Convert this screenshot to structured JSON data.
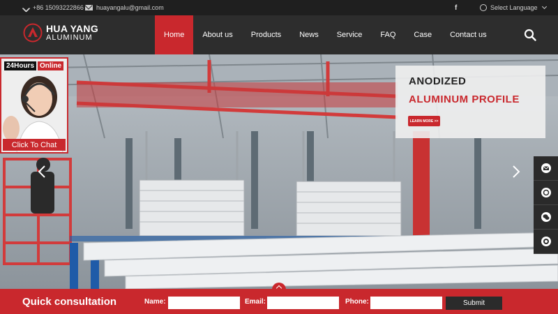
{
  "topbar": {
    "phone": "+86 15093222866",
    "email": "huayangalu@gmail.com",
    "facebook": "f",
    "language": "Select Language"
  },
  "logo": {
    "line1": "HUA YANG",
    "line2": "ALUMINUM"
  },
  "nav": {
    "items": [
      {
        "label": "Home",
        "active": true
      },
      {
        "label": "About us"
      },
      {
        "label": "Products"
      },
      {
        "label": "News"
      },
      {
        "label": "Service"
      },
      {
        "label": "FAQ"
      },
      {
        "label": "Case"
      },
      {
        "label": "Contact us"
      }
    ]
  },
  "hero": {
    "promo_line1": "ANODIZED",
    "promo_line2": "ALUMINUM PROFILE",
    "promo_button": "LEARN MORE >>"
  },
  "chat": {
    "hours": "24Hours",
    "online": "Online",
    "button": "Click To Chat"
  },
  "sidebar": {
    "icons": [
      "email-icon",
      "phone-icon",
      "wechat-icon",
      "whatsapp-icon"
    ]
  },
  "consult": {
    "title": "Quick consultation",
    "name_label": "Name:",
    "email_label": "Email:",
    "phone_label": "Phone:",
    "submit": "Submit"
  },
  "colors": {
    "accent": "#c9282d",
    "header": "#2d2d2d",
    "topbar": "#1f1f1f"
  }
}
